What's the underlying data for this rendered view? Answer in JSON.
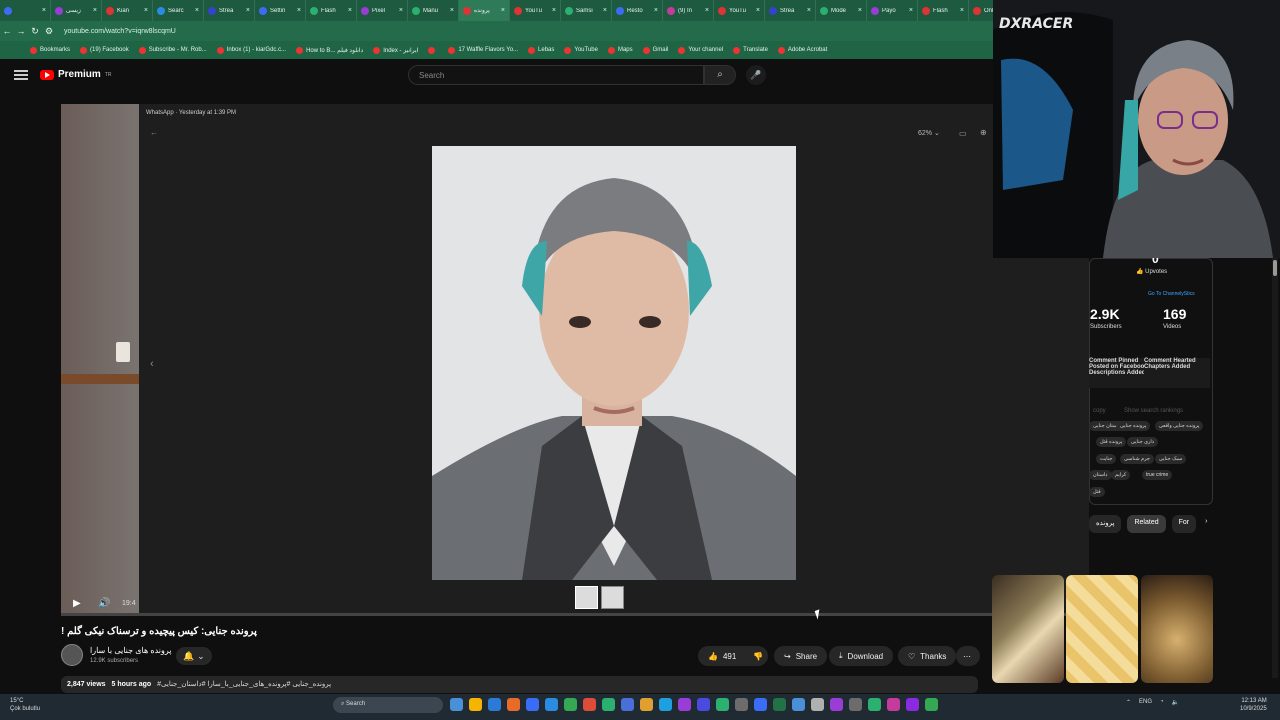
{
  "browser": {
    "tabs": [
      {
        "label": "",
        "color": "#3b6cf5"
      },
      {
        "label": "زیسی",
        "color": "#9a3cd6"
      },
      {
        "label": "Kian",
        "color": "#e03333"
      },
      {
        "label": "Searc",
        "color": "#2b8be0"
      },
      {
        "label": "Strea",
        "color": "#3344cc"
      },
      {
        "label": "Settin",
        "color": "#3b6cf5"
      },
      {
        "label": "Flash",
        "color": "#2bb070"
      },
      {
        "label": "Pixel",
        "color": "#9a3cd6"
      },
      {
        "label": "Manu",
        "color": "#2bb070"
      },
      {
        "label": "پرونده",
        "color": "#e03333"
      },
      {
        "label": "YouTu",
        "color": "#e03333"
      },
      {
        "label": "Samsi",
        "color": "#2bb070"
      },
      {
        "label": "Resto",
        "color": "#3b6cf5"
      },
      {
        "label": "(9) In",
        "color": "#c43b9b"
      },
      {
        "label": "YouTu",
        "color": "#e03333"
      },
      {
        "label": "Strea",
        "color": "#3344cc"
      },
      {
        "label": "Mode",
        "color": "#2bb070"
      },
      {
        "label": "Payo",
        "color": "#9a3cd6"
      },
      {
        "label": "Flash",
        "color": "#e03333"
      },
      {
        "label": "Onli",
        "color": "#e03333"
      }
    ],
    "active_tab_index": 9,
    "url": "youtube.com/watch?v=iqrw8lscqmU",
    "bookmarks": [
      "Bookmarks",
      "(19) Facebook",
      "Subscribe - Mr. Rob...",
      "Inbox (1) - kiarGdc.c...",
      "How to B... دانلود فیلم",
      "Index - ایرانیز",
      "",
      "17 Waffle Flavors Yo...",
      "Lebas",
      "YouTube",
      "Maps",
      "Gmail",
      "Your channel",
      "Translate",
      "Adobe Acrobat"
    ]
  },
  "youtube": {
    "logo_text": "Premium",
    "logo_sup": "TR",
    "search_placeholder": "Search"
  },
  "whatsapp": {
    "title": "WhatsApp · Yesterday at 1:39 PM",
    "zoom": "62%"
  },
  "player": {
    "time": "19:4"
  },
  "video": {
    "title": "! پرونده جنایی: کیس پیچیده و ترسناک نیکی گلم",
    "channel_name": "پرونده های جنایی با سارا",
    "subscribers": "12.9K subscribers",
    "likes": "491",
    "share_label": "Share",
    "download_label": "Download",
    "thanks_label": "Thanks",
    "views": "2,847 views",
    "posted": "5 hours ago",
    "hashtags": "#پرونده_جنایی #پرونده_های_جنایی_با_سارا #داستان_جنایی"
  },
  "sidebar": {
    "upvotes_count": "0",
    "upvotes_label": "Upvotes",
    "goto_label": "Go To ChannelyStics",
    "subs_value": "2.9K",
    "subs_label": "Subscribers",
    "videos_value": "169",
    "videos_label": "Videos",
    "stat_left": "Comment Pinned\nPosted on Facebook\nDescriptions Added",
    "stat_right": "Comment Hearted\nChapters Added",
    "copy_label": "copy",
    "rankings_label": "Show search rankings",
    "tags": [
      "داستان جنایی",
      "پرونده جنایی",
      "پرونده جنایی واقعی",
      "پرونده قتل",
      "ذاری جنایی",
      "جنایت",
      "جرم شناسی",
      "سبک جنایی",
      "داستان",
      "کرایم",
      "true crime",
      "قتل"
    ],
    "chips": [
      "پرونده",
      "Related",
      "For"
    ]
  },
  "taskbar": {
    "weather_temp": "15°C",
    "weather_desc": "Çok bulutlu",
    "search_placeholder": "Search",
    "lang": "ENG",
    "time": "12:13 AM",
    "date": "10/9/2025"
  }
}
